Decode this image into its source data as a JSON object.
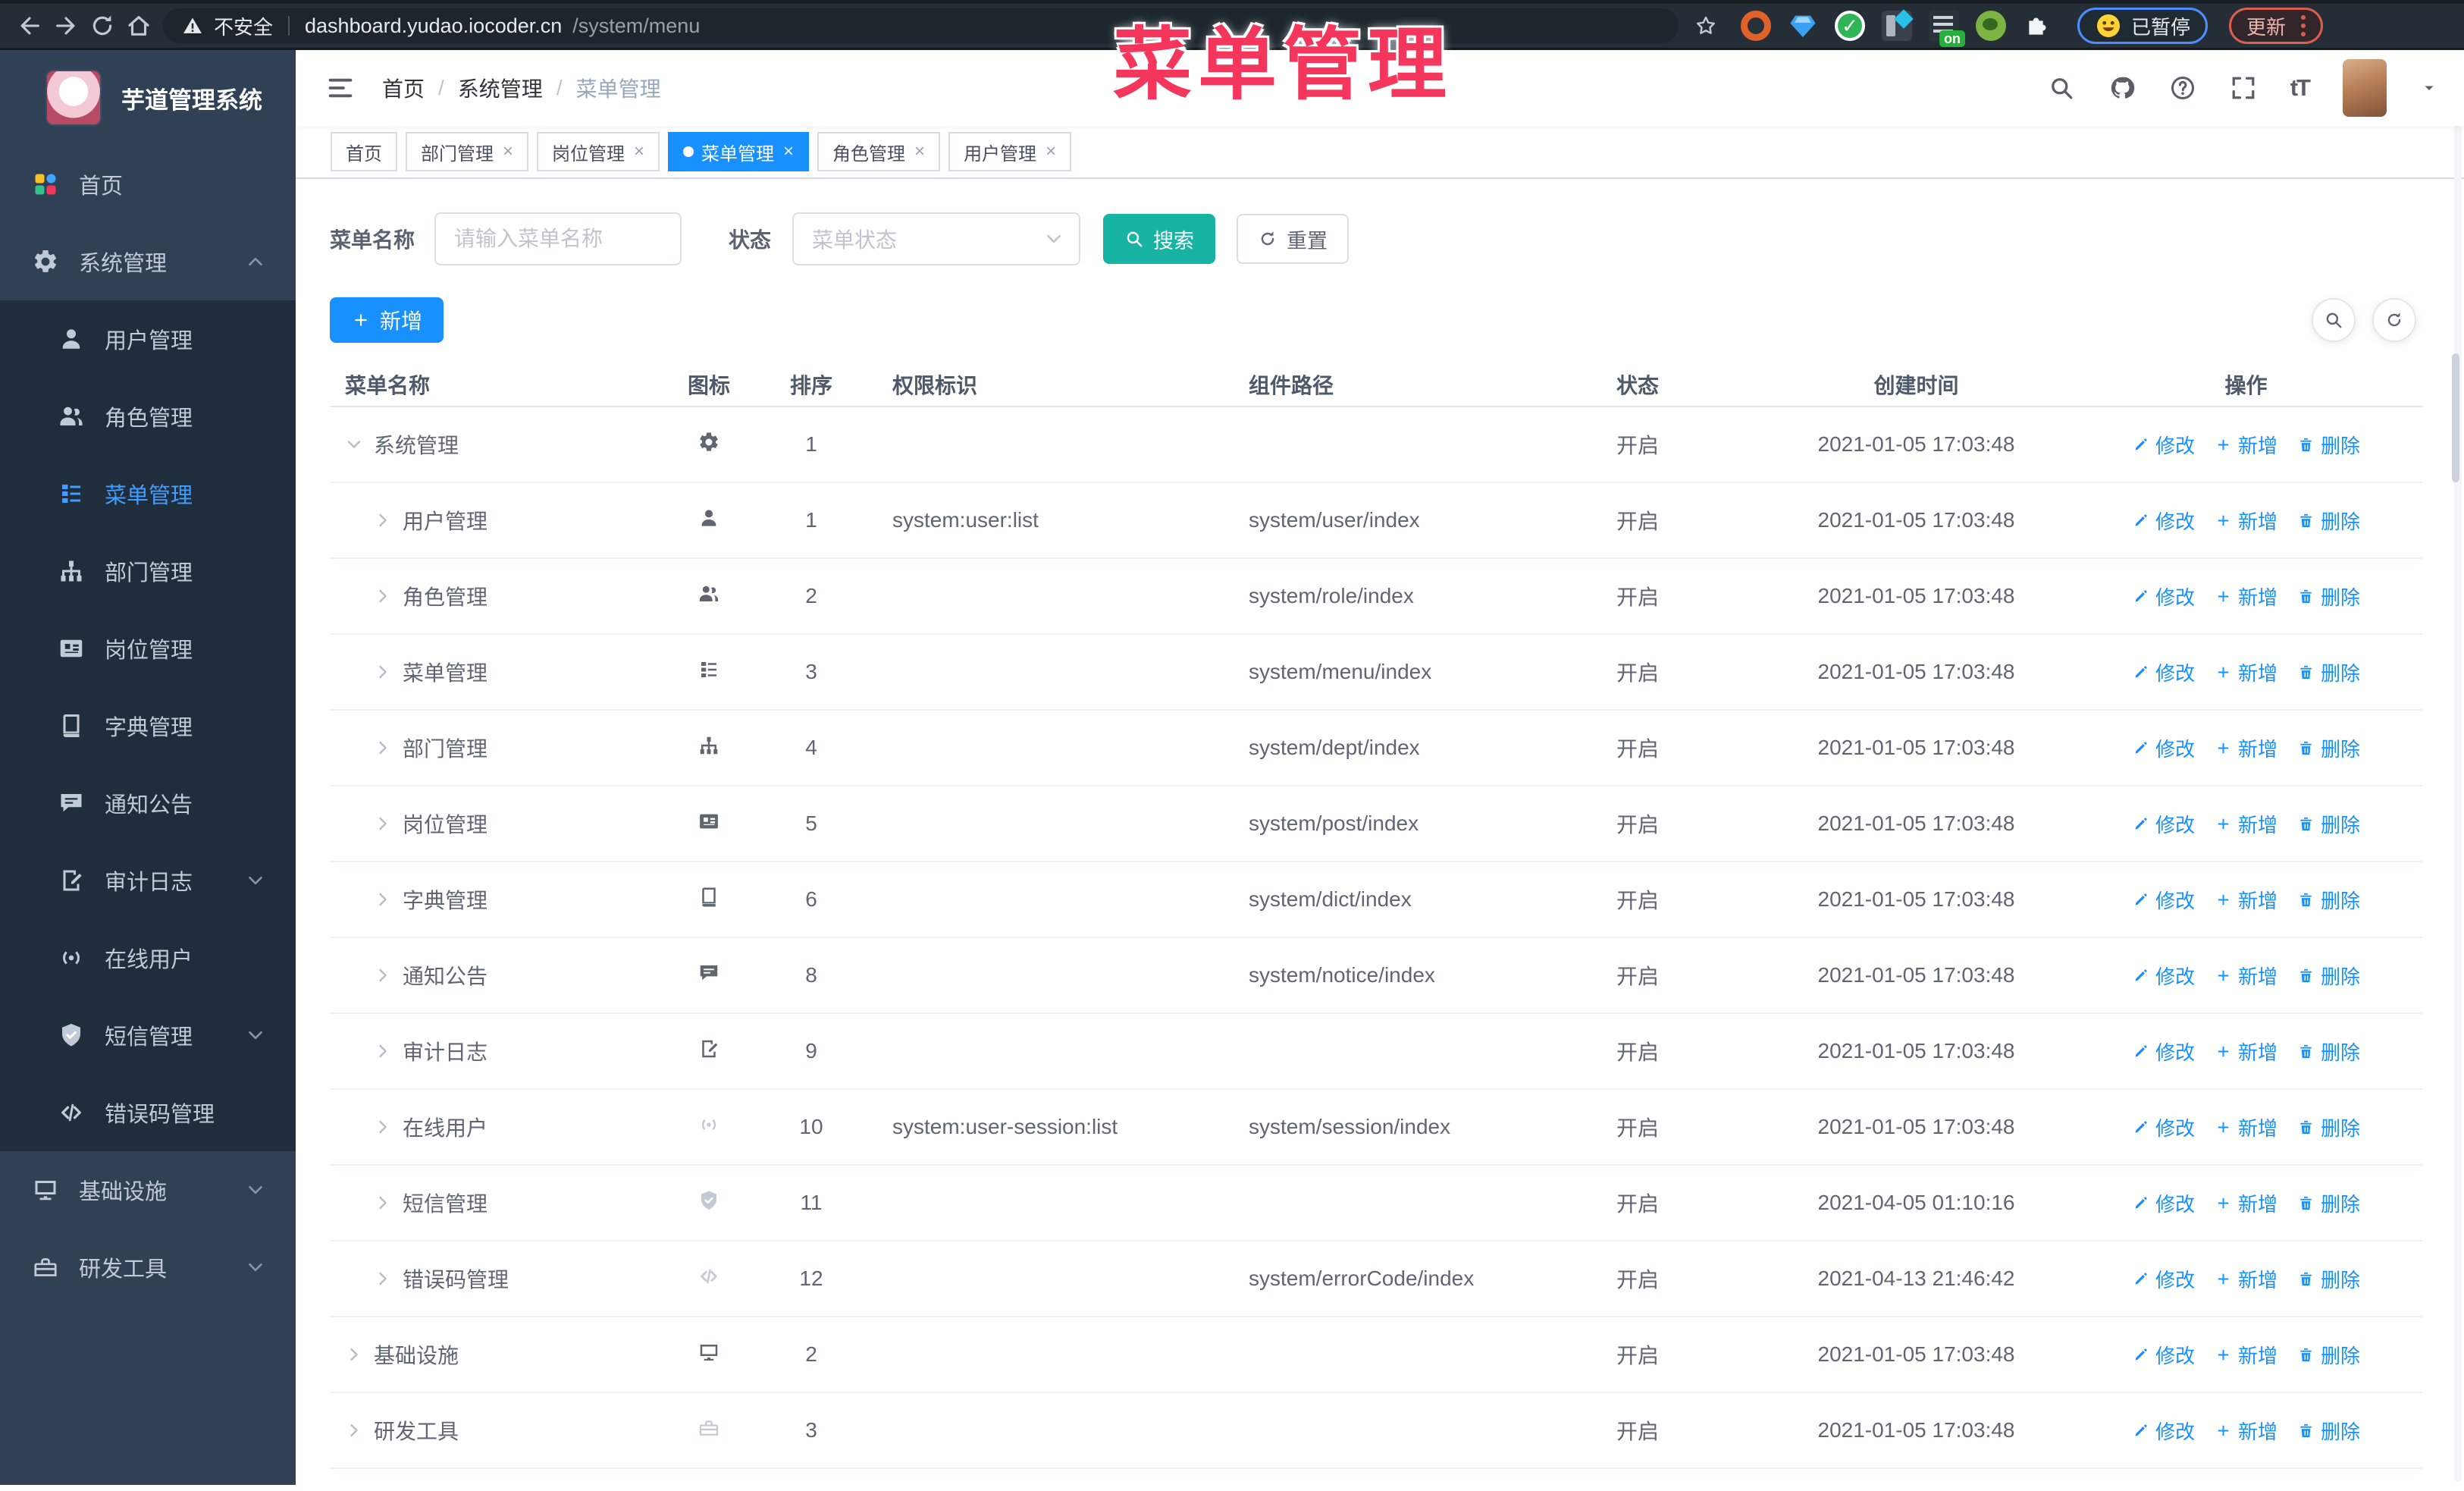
{
  "overlay": {
    "title": "菜单管理"
  },
  "browser": {
    "security": "不安全",
    "host": "dashboard.yudao.iocoder.cn",
    "path": "/system/menu",
    "on_badge": "on",
    "paused": "已暂停",
    "update": "更新"
  },
  "sidebar": {
    "title": "芋道管理系统",
    "items": [
      {
        "label": "首页",
        "icon": "dashboard-icon",
        "level": 0
      },
      {
        "label": "系统管理",
        "icon": "gear-icon",
        "level": 0,
        "arrow": "up"
      },
      {
        "label": "用户管理",
        "icon": "user-icon",
        "level": 1
      },
      {
        "label": "角色管理",
        "icon": "users-icon",
        "level": 1
      },
      {
        "label": "菜单管理",
        "icon": "menu-icon",
        "level": 1,
        "active": true
      },
      {
        "label": "部门管理",
        "icon": "tree-icon",
        "level": 1
      },
      {
        "label": "岗位管理",
        "icon": "badge-icon",
        "level": 1
      },
      {
        "label": "字典管理",
        "icon": "book-icon",
        "level": 1
      },
      {
        "label": "通知公告",
        "icon": "message-icon",
        "level": 1
      },
      {
        "label": "审计日志",
        "icon": "log-icon",
        "level": 1,
        "arrow": "down"
      },
      {
        "label": "在线用户",
        "icon": "online-icon",
        "level": 1
      },
      {
        "label": "短信管理",
        "icon": "shield-icon",
        "level": 1,
        "arrow": "down"
      },
      {
        "label": "错误码管理",
        "icon": "code-icon",
        "level": 1
      },
      {
        "label": "基础设施",
        "icon": "monitor-icon",
        "level": 0,
        "arrow": "down"
      },
      {
        "label": "研发工具",
        "icon": "toolbox-icon",
        "level": 0,
        "arrow": "down"
      }
    ]
  },
  "navbar": {
    "breadcrumb": [
      "首页",
      "系统管理",
      "菜单管理"
    ]
  },
  "tabs": [
    {
      "label": "首页",
      "closable": false,
      "active": false
    },
    {
      "label": "部门管理",
      "closable": true,
      "active": false
    },
    {
      "label": "岗位管理",
      "closable": true,
      "active": false
    },
    {
      "label": "菜单管理",
      "closable": true,
      "active": true
    },
    {
      "label": "角色管理",
      "closable": true,
      "active": false
    },
    {
      "label": "用户管理",
      "closable": true,
      "active": false
    }
  ],
  "search": {
    "name_label": "菜单名称",
    "name_placeholder": "请输入菜单名称",
    "status_label": "状态",
    "status_placeholder": "菜单状态",
    "search_button": "搜索",
    "reset_button": "重置"
  },
  "toolbar": {
    "add_button": "新增"
  },
  "table": {
    "headers": [
      "菜单名称",
      "图标",
      "排序",
      "权限标识",
      "组件路径",
      "状态",
      "创建时间",
      "操作"
    ],
    "action_labels": {
      "edit": "修改",
      "add": "新增",
      "delete": "删除"
    },
    "rows": [
      {
        "name": "系统管理",
        "icon": "gear-icon",
        "level": 0,
        "caret": "down",
        "sort": "1",
        "perm": "",
        "path": "",
        "status": "开启",
        "created": "2021-01-05 17:03:48",
        "muted": false
      },
      {
        "name": "用户管理",
        "icon": "user-icon",
        "level": 1,
        "caret": "right",
        "sort": "1",
        "perm": "system:user:list",
        "path": "system/user/index",
        "status": "开启",
        "created": "2021-01-05 17:03:48",
        "muted": false
      },
      {
        "name": "角色管理",
        "icon": "users-icon",
        "level": 1,
        "caret": "right",
        "sort": "2",
        "perm": "",
        "path": "system/role/index",
        "status": "开启",
        "created": "2021-01-05 17:03:48",
        "muted": false
      },
      {
        "name": "菜单管理",
        "icon": "menu-icon",
        "level": 1,
        "caret": "right",
        "sort": "3",
        "perm": "",
        "path": "system/menu/index",
        "status": "开启",
        "created": "2021-01-05 17:03:48",
        "muted": false
      },
      {
        "name": "部门管理",
        "icon": "tree-icon",
        "level": 1,
        "caret": "right",
        "sort": "4",
        "perm": "",
        "path": "system/dept/index",
        "status": "开启",
        "created": "2021-01-05 17:03:48",
        "muted": false
      },
      {
        "name": "岗位管理",
        "icon": "badge-icon",
        "level": 1,
        "caret": "right",
        "sort": "5",
        "perm": "",
        "path": "system/post/index",
        "status": "开启",
        "created": "2021-01-05 17:03:48",
        "muted": false
      },
      {
        "name": "字典管理",
        "icon": "book-icon",
        "level": 1,
        "caret": "right",
        "sort": "6",
        "perm": "",
        "path": "system/dict/index",
        "status": "开启",
        "created": "2021-01-05 17:03:48",
        "muted": false
      },
      {
        "name": "通知公告",
        "icon": "message-icon",
        "level": 1,
        "caret": "right",
        "sort": "8",
        "perm": "",
        "path": "system/notice/index",
        "status": "开启",
        "created": "2021-01-05 17:03:48",
        "muted": false
      },
      {
        "name": "审计日志",
        "icon": "log-icon",
        "level": 1,
        "caret": "right",
        "sort": "9",
        "perm": "",
        "path": "",
        "status": "开启",
        "created": "2021-01-05 17:03:48",
        "muted": false
      },
      {
        "name": "在线用户",
        "icon": "online-icon",
        "level": 1,
        "caret": "right",
        "sort": "10",
        "perm": "system:user-session:list",
        "path": "system/session/index",
        "status": "开启",
        "created": "2021-01-05 17:03:48",
        "muted": true
      },
      {
        "name": "短信管理",
        "icon": "shield-icon",
        "level": 1,
        "caret": "right",
        "sort": "11",
        "perm": "",
        "path": "",
        "status": "开启",
        "created": "2021-04-05 01:10:16",
        "muted": true
      },
      {
        "name": "错误码管理",
        "icon": "code-icon",
        "level": 1,
        "caret": "right",
        "sort": "12",
        "perm": "",
        "path": "system/errorCode/index",
        "status": "开启",
        "created": "2021-04-13 21:46:42",
        "muted": true
      },
      {
        "name": "基础设施",
        "icon": "monitor-icon",
        "level": 0,
        "caret": "right",
        "sort": "2",
        "perm": "",
        "path": "",
        "status": "开启",
        "created": "2021-01-05 17:03:48",
        "muted": false
      },
      {
        "name": "研发工具",
        "icon": "toolbox-icon",
        "level": 0,
        "caret": "right",
        "sort": "3",
        "perm": "",
        "path": "",
        "status": "开启",
        "created": "2021-01-05 17:03:48",
        "muted": true
      }
    ]
  },
  "colors": {
    "primary": "#1890ff",
    "search_teal": "#17b3a3",
    "overlay_pink": "#f5365c",
    "sidebar_bg": "#304156",
    "submenu_bg": "#1f2d3d",
    "active_link": "#409eff"
  }
}
